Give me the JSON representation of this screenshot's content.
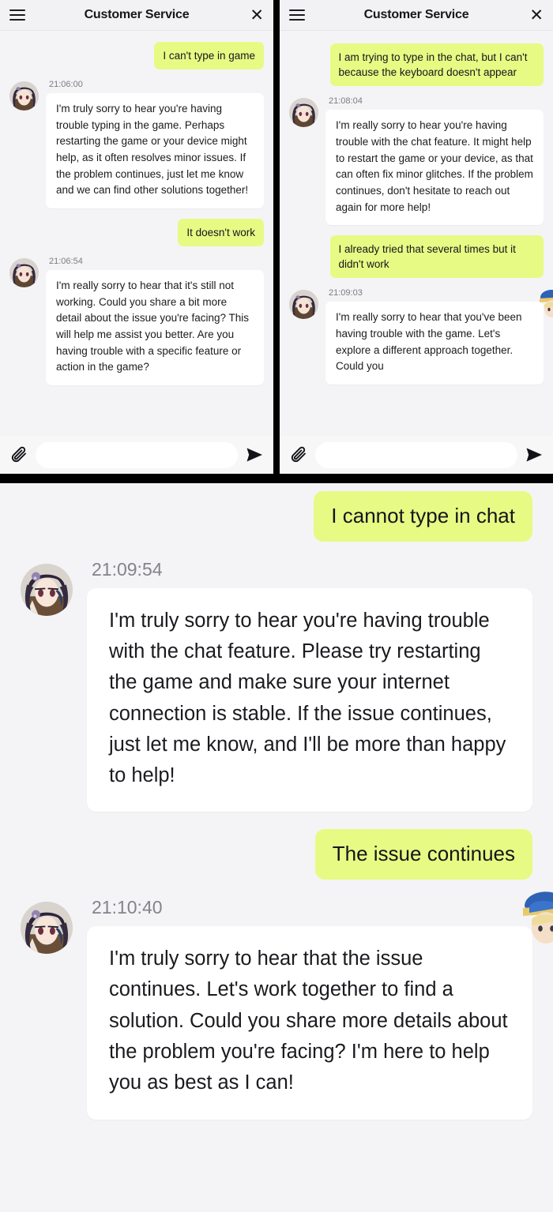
{
  "app": {
    "title": "Customer Service",
    "menu_icon": "hamburger-menu-icon",
    "close_icon": "close-icon",
    "bubble_user_color": "#e7fa84",
    "bubble_agent_color": "#ffffff",
    "background_color": "#f4f4f6",
    "header_color": "#f2f2f4"
  },
  "composer": {
    "attach_icon": "paperclip-icon",
    "send_icon": "send-paper-plane-icon",
    "placeholder": "",
    "value": ""
  },
  "panel_left": {
    "title": "Customer Service",
    "messages": [
      {
        "sender": "user",
        "text": "I can't type in game"
      },
      {
        "sender": "agent",
        "time": "21:06:00",
        "text": "I'm truly sorry to hear you're having trouble typing in the game. Perhaps restarting the game or your device might help, as it often resolves minor issues. If the problem continues, just let me know and we can find other solutions together!"
      },
      {
        "sender": "user",
        "text": "It doesn't work"
      },
      {
        "sender": "agent",
        "time": "21:06:54",
        "text": "I'm really sorry to hear that it's still not working. Could you share a bit more detail about the issue you're facing? This will help me assist you better. Are you having trouble with a specific feature or action in the game?"
      }
    ]
  },
  "panel_right": {
    "title": "Customer Service",
    "messages": [
      {
        "sender": "user",
        "text": "I am trying to type in the chat, but I can't because the keyboard doesn't appear"
      },
      {
        "sender": "agent",
        "time": "21:08:04",
        "text": "I'm really sorry to hear you're having trouble with the chat feature. It might help to restart the game or your device, as that can often fix minor glitches. If the problem continues, don't hesitate to reach out again for more help!"
      },
      {
        "sender": "user",
        "text": "I already tried that several times but it didn't work"
      },
      {
        "sender": "agent",
        "time": "21:09:03",
        "text": "I'm really sorry to hear that you've been having trouble with the game. Let's explore a different approach together. Could you"
      }
    ]
  },
  "panel_zoom": {
    "messages": [
      {
        "sender": "user",
        "text": "I cannot type in chat"
      },
      {
        "sender": "agent",
        "time": "21:09:54",
        "text": "I'm truly sorry to hear you're having trouble with the chat feature. Please try restarting the game and make sure your internet connection is stable. If the issue continues, just let me know, and I'll be more than happy to help!"
      },
      {
        "sender": "user",
        "text": "The issue continues"
      },
      {
        "sender": "agent",
        "time": "21:10:40",
        "text": "I'm truly sorry to hear that the issue continues. Let's work together to find a solution. Could you share more details about the problem you're facing? I'm here to help you as best as I can!"
      }
    ]
  }
}
